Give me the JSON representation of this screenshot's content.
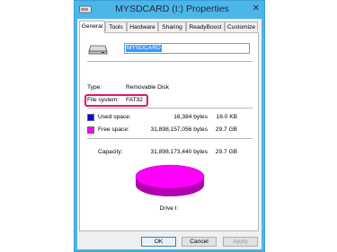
{
  "window": {
    "title": "MYSDCARD (I:) Properties",
    "close_glyph": "✕"
  },
  "tabs": [
    {
      "label": "General",
      "active": true
    },
    {
      "label": "Tools"
    },
    {
      "label": "Hardware"
    },
    {
      "label": "Sharing"
    },
    {
      "label": "ReadyBoost"
    },
    {
      "label": "Customize"
    }
  ],
  "general": {
    "drive_name": "MYSDCARD",
    "type_label": "Type:",
    "type_value": "Removable Disk",
    "fs_label": "File system:",
    "fs_value": "FAT32",
    "used_label": "Used space:",
    "used_bytes": "16,384 bytes",
    "used_human": "16.0 KB",
    "free_label": "Free space:",
    "free_bytes": "31,898,157,056 bytes",
    "free_human": "29.7 GB",
    "capacity_label": "Capacity:",
    "capacity_bytes": "31,898,173,440 bytes",
    "capacity_human": "29.7 GB",
    "drive_caption": "Drive I:",
    "used_color": "#0000ff",
    "free_color": "#ff00ff",
    "highlight_color": "#e0136e"
  },
  "buttons": {
    "ok": "OK",
    "cancel": "Cancel",
    "apply": "Apply"
  }
}
